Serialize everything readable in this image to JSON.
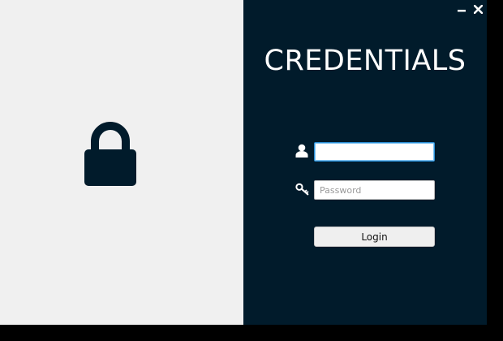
{
  "window": {
    "minimize_icon": "minimize-icon",
    "close_icon": "close-icon"
  },
  "left_panel": {
    "icon": "lock-icon",
    "background": "#f0f0f0",
    "icon_color": "#011b2b"
  },
  "right_panel": {
    "background": "#011b2b",
    "title": "CREDENTIALS",
    "username": {
      "icon": "user-icon",
      "value": "",
      "placeholder": ""
    },
    "password": {
      "icon": "key-icon",
      "value": "",
      "placeholder": "Password"
    },
    "login_label": "Login"
  }
}
